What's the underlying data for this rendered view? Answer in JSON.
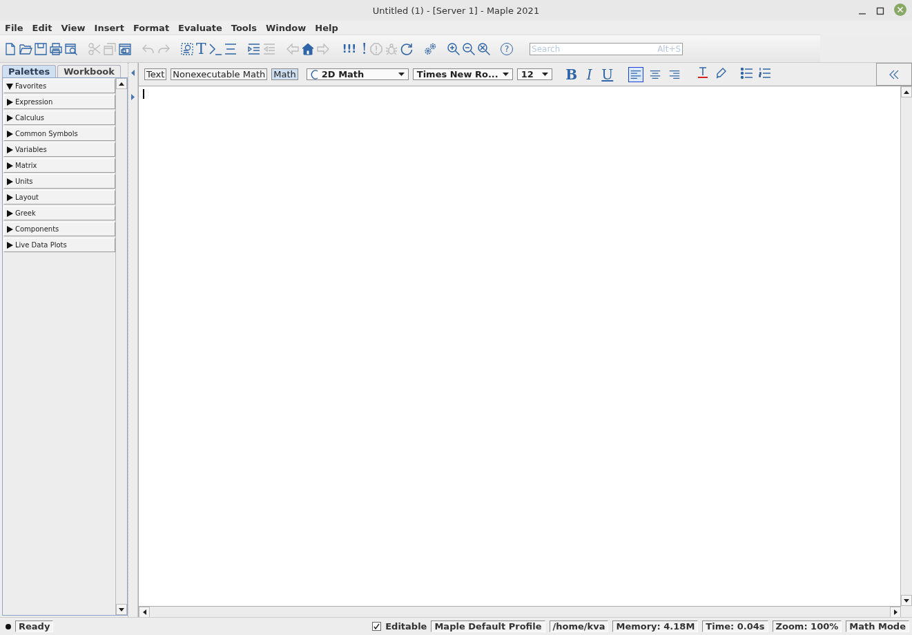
{
  "window": {
    "title": "Untitled (1) - [Server 1] - Maple 2021"
  },
  "menu": [
    {
      "label": "File"
    },
    {
      "label": "Edit"
    },
    {
      "label": "View"
    },
    {
      "label": "Insert"
    },
    {
      "label": "Format"
    },
    {
      "label": "Evaluate"
    },
    {
      "label": "Tools"
    },
    {
      "label": "Window"
    },
    {
      "label": "Help"
    }
  ],
  "toolbar": {
    "groups": [
      {
        "buttons": [
          {
            "kind": "new",
            "disabled": false
          },
          {
            "kind": "open",
            "disabled": false
          },
          {
            "kind": "save",
            "disabled": false
          },
          {
            "kind": "print",
            "disabled": false
          },
          {
            "kind": "preview",
            "disabled": false
          }
        ]
      },
      {
        "buttons": [
          {
            "kind": "cut",
            "disabled": true
          },
          {
            "kind": "copy",
            "disabled": true
          },
          {
            "kind": "paste",
            "disabled": false
          }
        ]
      },
      {
        "buttons": [
          {
            "kind": "undo",
            "disabled": true
          },
          {
            "kind": "redo",
            "disabled": true
          }
        ]
      },
      {
        "buttons": [
          {
            "kind": "convert",
            "disabled": false
          },
          {
            "kind": "text",
            "label": "T",
            "disabled": false
          },
          {
            "kind": "prompt",
            "disabled": false
          },
          {
            "kind": "section",
            "disabled": false
          }
        ]
      },
      {
        "buttons": [
          {
            "kind": "indent",
            "disabled": false
          },
          {
            "kind": "outdent",
            "disabled": true
          }
        ]
      },
      {
        "buttons": [
          {
            "kind": "back",
            "disabled": true
          },
          {
            "kind": "home",
            "disabled": false
          },
          {
            "kind": "forward",
            "disabled": true
          }
        ]
      },
      {
        "buttons": [
          {
            "kind": "text",
            "label": "!!!",
            "disabled": false
          },
          {
            "kind": "text",
            "label": "!",
            "disabled": false
          },
          {
            "kind": "stop",
            "disabled": true
          },
          {
            "kind": "debug",
            "disabled": true
          },
          {
            "kind": "restart",
            "disabled": false
          }
        ]
      },
      {
        "buttons": [
          {
            "kind": "gears",
            "disabled": false
          }
        ]
      },
      {
        "buttons": [
          {
            "kind": "zoom-in",
            "disabled": false
          },
          {
            "kind": "zoom-out",
            "disabled": false
          },
          {
            "kind": "zoom-fit",
            "disabled": false
          }
        ]
      },
      {
        "buttons": [
          {
            "kind": "circled",
            "label": "?",
            "disabled": false
          }
        ]
      }
    ],
    "search": {
      "placeholder": "Search",
      "shortcut": "Alt+S"
    }
  },
  "palettes": {
    "tabs": [
      {
        "label": "Palettes",
        "selected": true
      },
      {
        "label": "Workbook",
        "selected": false
      }
    ],
    "items": [
      {
        "label": "Favorites",
        "expanded": true
      },
      {
        "label": "Expression",
        "expanded": false
      },
      {
        "label": "Calculus",
        "expanded": false
      },
      {
        "label": "Common Symbols",
        "expanded": false
      },
      {
        "label": "Variables",
        "expanded": false
      },
      {
        "label": "Matrix",
        "expanded": false
      },
      {
        "label": "Units",
        "expanded": false
      },
      {
        "label": "Layout",
        "expanded": false
      },
      {
        "label": "Greek",
        "expanded": false
      },
      {
        "label": "Components",
        "expanded": false
      },
      {
        "label": "Live Data Plots",
        "expanded": false
      }
    ]
  },
  "format_bar": {
    "modes": [
      {
        "label": "Text",
        "selected": false
      },
      {
        "label": "Nonexecutable Math",
        "selected": false
      },
      {
        "label": "Math",
        "selected": true
      }
    ],
    "style": "2D Math",
    "font": "Times New Ro...",
    "size": "12",
    "emphasis": [
      {
        "kind": "bold",
        "label": "B"
      },
      {
        "kind": "italic",
        "label": "I"
      },
      {
        "kind": "underline",
        "label": "U"
      }
    ],
    "alignment": [
      {
        "kind": "left",
        "selected": true
      },
      {
        "kind": "center",
        "selected": false
      },
      {
        "kind": "right",
        "selected": false
      }
    ]
  },
  "status_bar": {
    "state": "Ready",
    "editable": true,
    "editable_label": "Editable",
    "fields": [
      "Maple Default Profile",
      "/home/kva",
      "Memory: 4.18M",
      "Time: 0.04s",
      "Zoom: 100%",
      "Math Mode"
    ]
  }
}
